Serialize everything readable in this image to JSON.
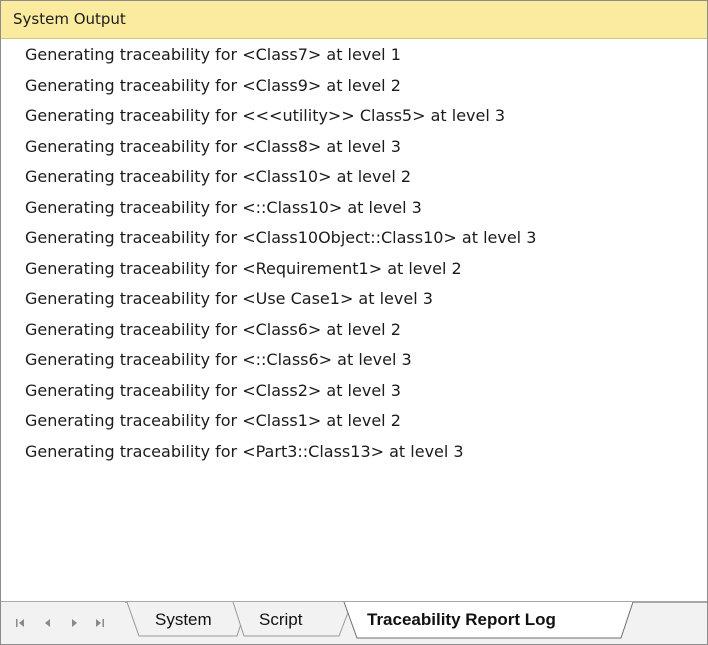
{
  "panel": {
    "title": "System Output"
  },
  "output_lines": [
    "Generating traceability for <Class7> at level 1",
    "Generating traceability for <Class9> at level 2",
    "Generating traceability for <<<utility>> Class5> at level 3",
    "Generating traceability for <Class8> at level 3",
    "Generating traceability for <Class10> at level 2",
    "Generating traceability for <::Class10> at level 3",
    "Generating traceability for <Class10Object::Class10> at level 3",
    "Generating traceability for <Requirement1> at level 2",
    "Generating traceability for <Use Case1> at level 3",
    "Generating traceability for <Class6> at level 2",
    "Generating traceability for <::Class6> at level 3",
    "Generating traceability for <Class2> at level 3",
    "Generating traceability for <Class1> at level 2",
    "Generating traceability for <Part3::Class13> at level 3"
  ],
  "tabs": [
    {
      "label": "System",
      "active": false
    },
    {
      "label": "Script",
      "active": false
    },
    {
      "label": "Traceability Report Log",
      "active": true
    }
  ],
  "tab_nav": {
    "icons": [
      "first-tab-icon",
      "previous-tab-icon",
      "next-tab-icon",
      "last-tab-icon"
    ]
  },
  "colors": {
    "title_bar": "#fbeb9e",
    "tab_bar": "#f2f2f2",
    "text": "#1b1b1b",
    "nav_icon": "#8a8a8a"
  }
}
